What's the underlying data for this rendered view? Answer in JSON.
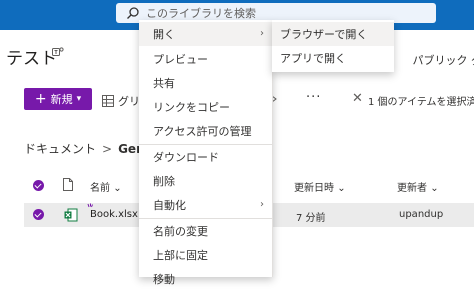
{
  "search": {
    "placeholder": "このライブラリを検索"
  },
  "site": {
    "title": "テスト",
    "visibility": "パブリック グ"
  },
  "toolbar": {
    "new_label": "新規",
    "grid_label": "グリッ",
    "more": "···",
    "selection_text": "1 個のアイテムを選択済",
    "accent_color": "#7719aa"
  },
  "breadcrumb": {
    "root": "ドキュメント",
    "separator": ">",
    "current": "Gener"
  },
  "table": {
    "headers": {
      "name": "名前",
      "modified": "更新日時",
      "modified_by": "更新者"
    },
    "rows": [
      {
        "name": "Book.xlsx",
        "modified": "7 分前",
        "modified_by": "upandup"
      }
    ]
  },
  "context_menu": {
    "items": [
      {
        "label": "開く",
        "has_submenu": true
      },
      {
        "label": "プレビュー"
      },
      {
        "label": "共有"
      },
      {
        "label": "リンクをコピー"
      },
      {
        "label": "アクセス許可の管理"
      },
      {
        "label": "ダウンロード"
      },
      {
        "label": "削除"
      },
      {
        "label": "自動化",
        "has_submenu": true
      },
      {
        "label": "名前の変更"
      },
      {
        "label": "上部に固定"
      },
      {
        "label": "移動"
      }
    ]
  },
  "submenu": {
    "items": [
      {
        "label": "ブラウザーで開く"
      },
      {
        "label": "アプリで開く"
      }
    ]
  }
}
